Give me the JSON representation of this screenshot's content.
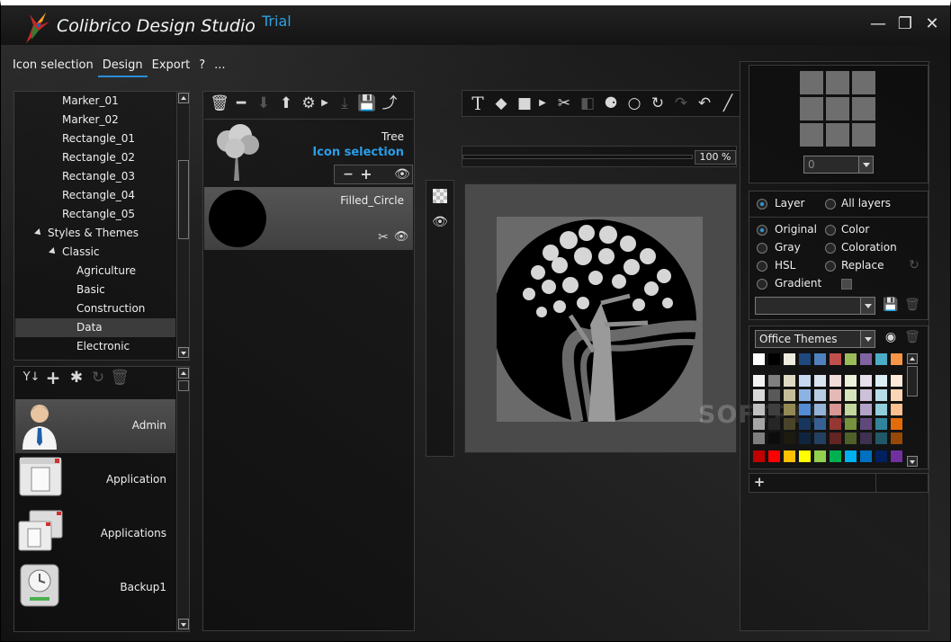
{
  "app": {
    "title": "Colibrico Design Studio",
    "edition": "Trial"
  },
  "window_controls": {
    "minimize": "—",
    "restore": "❐",
    "close": "✕"
  },
  "menu": {
    "items": [
      {
        "label": "Icon selection",
        "active": false
      },
      {
        "label": "Design",
        "active": true
      },
      {
        "label": "Export",
        "active": false
      },
      {
        "label": "?",
        "active": false
      },
      {
        "label": "...",
        "active": false
      }
    ]
  },
  "tree": {
    "items": [
      {
        "label": "Marker_01",
        "level": 2
      },
      {
        "label": "Marker_02",
        "level": 2
      },
      {
        "label": "Rectangle_01",
        "level": 2
      },
      {
        "label": "Rectangle_02",
        "level": 2
      },
      {
        "label": "Rectangle_03",
        "level": 2
      },
      {
        "label": "Rectangle_04",
        "level": 2
      },
      {
        "label": "Rectangle_05",
        "level": 2
      },
      {
        "label": "Styles & Themes",
        "level": 1,
        "expanded": true
      },
      {
        "label": "Classic",
        "level": 2,
        "expanded": true
      },
      {
        "label": "Agriculture",
        "level": 3
      },
      {
        "label": "Basic",
        "level": 3
      },
      {
        "label": "Construction",
        "level": 3
      },
      {
        "label": "Data",
        "level": 3,
        "selected": true
      },
      {
        "label": "Electronic",
        "level": 3
      }
    ]
  },
  "library": {
    "items": [
      {
        "label": "Admin",
        "icon": "admin-user-icon",
        "selected": true
      },
      {
        "label": "Application",
        "icon": "application-window-icon"
      },
      {
        "label": "Applications",
        "icon": "applications-windows-icon"
      },
      {
        "label": "Backup1",
        "icon": "backup-drive-icon"
      }
    ]
  },
  "layers": {
    "source_name": "Tree",
    "source_link": "Icon selection",
    "items": [
      {
        "label": "Filled_Circle"
      }
    ]
  },
  "canvas": {
    "zoom": "100 %"
  },
  "color_panel": {
    "size_select": "0",
    "scope": {
      "layer": "Layer",
      "all_layers": "All layers"
    },
    "modes": [
      "Original",
      "Color",
      "Gray",
      "Coloration",
      "HSL",
      "Replace",
      "Gradient"
    ],
    "selected_mode": "Original",
    "theme_select": "Office Themes"
  },
  "palette": {
    "top_row": [
      "#ffffff",
      "#000000",
      "#eeece1",
      "#1f497d",
      "#4f81bd",
      "#c0504d",
      "#9bbb59",
      "#8064a2",
      "#4bacc6",
      "#f79646"
    ],
    "tints": [
      [
        "#f2f2f2",
        "#7f7f7f",
        "#ddd9c3",
        "#c6d9f0",
        "#dbe5f1",
        "#f2dcdb",
        "#ebf1dd",
        "#e5e0ec",
        "#dbeef3",
        "#fdeada"
      ],
      [
        "#d8d8d8",
        "#595959",
        "#c4bd97",
        "#8db3e2",
        "#b8cce4",
        "#e5b9b7",
        "#d7e3bc",
        "#ccc1d9",
        "#b7dde8",
        "#fbd5b5"
      ],
      [
        "#bfbfbf",
        "#3f3f3f",
        "#938953",
        "#548dd4",
        "#95b3d7",
        "#d99694",
        "#c3d69b",
        "#b2a2c7",
        "#92cddc",
        "#fac08f"
      ],
      [
        "#a5a5a5",
        "#262626",
        "#494429",
        "#17365d",
        "#366092",
        "#953734",
        "#76923c",
        "#5f497a",
        "#31859b",
        "#e36c09"
      ],
      [
        "#7f7f7f",
        "#0c0c0c",
        "#1d1b10",
        "#0f243e",
        "#244061",
        "#632423",
        "#4f6128",
        "#3f3151",
        "#205867",
        "#974806"
      ]
    ],
    "standard": [
      "#c00000",
      "#ff0000",
      "#ffc000",
      "#ffff00",
      "#92d050",
      "#00b050",
      "#00b0f0",
      "#0070c0",
      "#002060",
      "#7030a0"
    ]
  },
  "watermark": "SOFTPEDIA"
}
